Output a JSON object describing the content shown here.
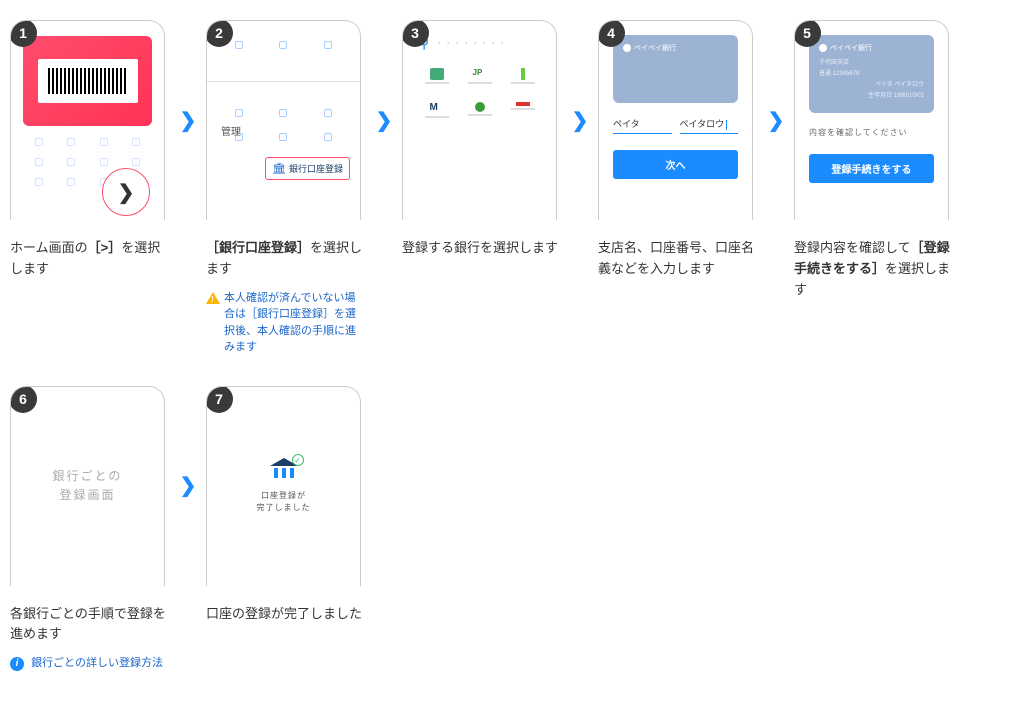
{
  "steps": [
    {
      "num": "1",
      "desc_pre": "ホーム画面の",
      "desc_bold": "［>］",
      "desc_post": "を選択します"
    },
    {
      "num": "2",
      "desc_bold": "［銀行口座登録］",
      "desc_post": "を選択します",
      "warning": "本人確認が済んでいない場合は［銀行口座登録］を選択後、本人確認の手順に進みます",
      "panel_label": "管理",
      "button_label": "銀行口座登録"
    },
    {
      "num": "3",
      "desc": "登録する銀行を選択します",
      "search_placeholder": "・・・・・・・・"
    },
    {
      "num": "4",
      "desc": "支店名、口座番号、口座名義などを入力します",
      "card_name": "ペイペイ銀行",
      "input1": "ペイタ",
      "input2": "ペイタロウ",
      "button": "次へ"
    },
    {
      "num": "5",
      "desc_pre": "登録内容を確認して",
      "desc_bold": "［登録手続きをする］",
      "desc_post": "を選択します",
      "card_name": "ペイペイ銀行",
      "card_line1": "千代田支店",
      "card_line2": "普通 12345678",
      "card_line3": "ペイタ ペイタロウ",
      "card_line4": "生年月日 1990/10/01",
      "msg": "内容を確認してください",
      "button": "登録手続きをする"
    },
    {
      "num": "6",
      "desc": "各銀行ごとの手順で登録を進めます",
      "panel_line1": "銀行ごとの",
      "panel_line2": "登録画面",
      "info_link": "銀行ごとの詳しい登録方法"
    },
    {
      "num": "7",
      "desc": "口座の登録が完了しました",
      "panel_line1": "口座登録が",
      "panel_line2": "完了しました"
    }
  ]
}
